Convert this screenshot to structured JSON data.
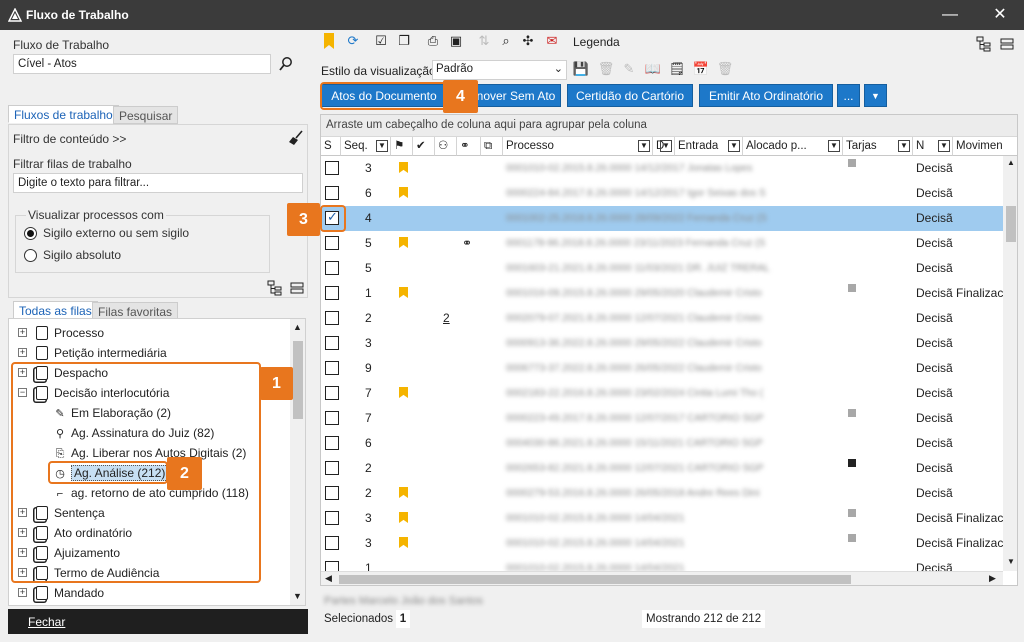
{
  "window": {
    "title": "Fluxo de Trabalho",
    "min": "—",
    "close": "✕"
  },
  "left": {
    "workflow_label": "Fluxo de Trabalho",
    "workflow_value": "Cível - Atos",
    "tabs": [
      "Fluxos de trabalho",
      "Pesquisar"
    ],
    "content_filter": "Filtro de conteúdo >>",
    "filter_label": "Filtrar filas de trabalho",
    "filter_placeholder": "Digite o texto para filtrar...",
    "visualize_label": "Visualizar processos com",
    "radio_external": "Sigilo externo ou sem sigilo",
    "radio_absolute": "Sigilo absoluto",
    "queue_tabs": [
      "Todas as filas",
      "Filas favoritas"
    ],
    "tree": [
      {
        "label": "Processo",
        "level": 0,
        "exp": "+"
      },
      {
        "label": "Petição intermediária",
        "level": 0,
        "exp": "+"
      },
      {
        "label": "Despacho",
        "level": 0,
        "exp": "+"
      },
      {
        "label": "Decisão interlocutória",
        "level": 0,
        "exp": "−"
      },
      {
        "label": "Em Elaboração (2)",
        "level": 1,
        "icon": "pen-icon"
      },
      {
        "label": "Ag. Assinatura do Juiz (82)",
        "level": 1,
        "icon": "signature-icon"
      },
      {
        "label": "Ag. Liberar nos Autos Digitais (2)",
        "level": 1,
        "icon": "release-icon"
      },
      {
        "label": "Ag. Análise (212)",
        "level": 1,
        "icon": "clock-icon",
        "selected": true
      },
      {
        "label": "ag. retorno de ato cumprido (118)",
        "level": 1,
        "icon": "return-icon"
      },
      {
        "label": "Sentença",
        "level": 0,
        "exp": "+"
      },
      {
        "label": "Ato ordinatório",
        "level": 0,
        "exp": "+"
      },
      {
        "label": "Ajuizamento",
        "level": 0,
        "exp": "+"
      },
      {
        "label": "Termo de Audiência",
        "level": 0,
        "exp": "+"
      },
      {
        "label": "Mandado",
        "level": 0,
        "exp": "+"
      }
    ],
    "close_button": "Fechar"
  },
  "callouts": [
    "1",
    "2",
    "3",
    "4"
  ],
  "toolbar": {
    "legend": "Legenda",
    "view_style_label": "Estilo da visualização:",
    "view_style_value": "Padrão"
  },
  "actions": {
    "atos": "Atos do Documento",
    "remover": "nover Sem Ato",
    "certidao": "Certidão do Cartório",
    "emitir": "Emitir Ato Ordinatório",
    "more": "...",
    "dropdown": "▼"
  },
  "grid": {
    "group_hint": "Arraste um cabeçalho de coluna aqui para agrupar pela coluna",
    "headers": [
      "S",
      "Seq.",
      "",
      "",
      "",
      "",
      "",
      "Processo",
      "D",
      "Entrada",
      "Alocado p...",
      "Tarjas",
      "N",
      "Movimen"
    ],
    "rows": [
      {
        "seq": "3",
        "flag": true,
        "proc": "0001010-02.2015.8.26.0000 14/12/2017 Jonatas Lopes",
        "tarja": "grey",
        "n": "Decisã",
        "mov": ""
      },
      {
        "seq": "6",
        "flag": true,
        "proc": "0000224-84.2017.8.26.0000 14/12/2017 Igor Seixas dos S",
        "tarja": "",
        "n": "Decisã",
        "mov": ""
      },
      {
        "seq": "4",
        "flag": false,
        "proc": "0001002-25.2018.8.26.0000 28/09/2022 Fernanda Cruz (S",
        "tarja": "",
        "n": "Decisã",
        "mov": "",
        "selected": true
      },
      {
        "seq": "5",
        "flag": true,
        "link": true,
        "proc": "0001178-96.2018.8.26.0000 23/11/2023 Fernanda Cruz (S",
        "tarja": "",
        "n": "Decisã",
        "mov": ""
      },
      {
        "seq": "5",
        "flag": false,
        "proc": "0001603-21.2021.8.26.0000 11/03/2021 DR. JUIZ TRERAL",
        "tarja": "",
        "n": "Decisã",
        "mov": ""
      },
      {
        "seq": "1",
        "flag": true,
        "proc": "0001016-09.2015.8.26.0000 29/05/2020 Claudemir Cristo",
        "tarja": "grey",
        "n": "Decisã",
        "mov": "Finalizac"
      },
      {
        "seq": "2",
        "flag": false,
        "num": "2",
        "proc": "0002079-07.2021.8.26.0000 12/07/2021 Claudemir Cristo",
        "tarja": "",
        "n": "Decisã",
        "mov": ""
      },
      {
        "seq": "3",
        "flag": false,
        "proc": "0000913-36.2022.8.26.0000 29/05/2022 Claudemir Cristo",
        "tarja": "",
        "n": "Decisã",
        "mov": ""
      },
      {
        "seq": "9",
        "flag": false,
        "proc": "0006773-37.2022.8.26.0000 26/05/2022 Claudemir Cristo",
        "tarja": "",
        "n": "Decisã",
        "mov": ""
      },
      {
        "seq": "7",
        "flag": true,
        "proc": "0002183-22.2016.8.26.0000 23/02/2024 Cintia Lumi Tho (",
        "tarja": "",
        "n": "Decisã",
        "mov": ""
      },
      {
        "seq": "7",
        "flag": false,
        "proc": "0000223-49.2017.8.26.0000 12/07/2017 CARTORIO SGP",
        "tarja": "grey",
        "n": "Decisã",
        "mov": ""
      },
      {
        "seq": "6",
        "flag": false,
        "proc": "0004030-86.2021.8.26.0000 15/11/2021 CARTORIO SGP",
        "tarja": "",
        "n": "Decisã",
        "mov": ""
      },
      {
        "seq": "2",
        "flag": false,
        "proc": "0002653-82.2021.8.26.0000 12/07/2021 CARTORIO SGP",
        "tarja": "dark",
        "n": "Decisã",
        "mov": ""
      },
      {
        "seq": "2",
        "flag": true,
        "proc": "0000279-53.2016.8.26.0000 26/05/2018 Andre Rees Dini",
        "tarja": "",
        "n": "Decisã",
        "mov": ""
      },
      {
        "seq": "3",
        "flag": true,
        "proc": "0001010-02.2015.8.26.0000 14/04/2021",
        "tarja": "grey",
        "n": "Decisã",
        "mov": "Finalizac"
      },
      {
        "seq": "3",
        "flag": true,
        "proc": "0001010-02.2015.8.26.0000 14/04/2021",
        "tarja": "grey",
        "n": "Decisã",
        "mov": "Finalizac"
      },
      {
        "seq": "1",
        "flag": false,
        "proc": "0001010-02.2015.8.26.0000 14/04/2021",
        "tarja": "",
        "n": "Decisã",
        "mov": ""
      }
    ]
  },
  "footer": {
    "parties": "Partes Marcelo João dos Santos",
    "selected_label": "Selecionados",
    "selected_count": "1",
    "showing": "Mostrando 212 de 212"
  },
  "colors": {
    "accent": "#1d78c9",
    "callout": "#e8761e",
    "selection": "#9fcbef",
    "flag": "#f5b400"
  }
}
